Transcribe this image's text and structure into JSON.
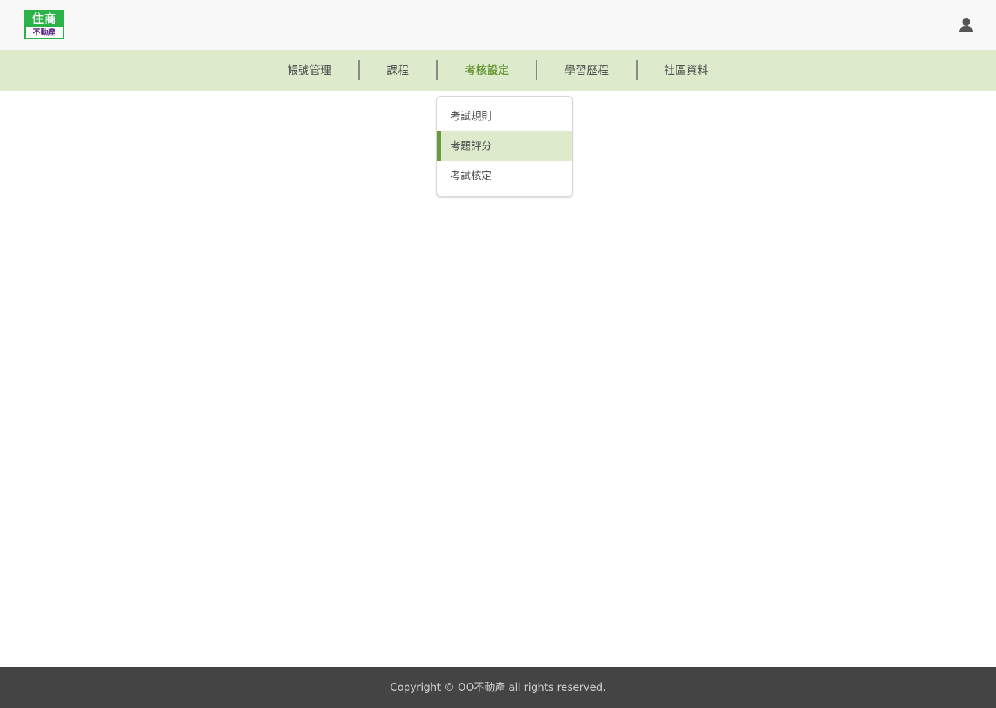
{
  "header": {
    "logo": {
      "top_text": "住商",
      "bottom_text": "不動產"
    },
    "user_icon": "user-icon"
  },
  "nav": {
    "items": [
      {
        "label": "帳號管理",
        "active": false
      },
      {
        "label": "課程",
        "active": false
      },
      {
        "label": "考核設定",
        "active": true
      },
      {
        "label": "學習歷程",
        "active": false
      },
      {
        "label": "社區資料",
        "active": false
      }
    ]
  },
  "dropdown": {
    "items": [
      {
        "label": "考試規則",
        "selected": false
      },
      {
        "label": "考題評分",
        "selected": true
      },
      {
        "label": "考試核定",
        "selected": false
      }
    ]
  },
  "footer": {
    "text": "Copyright © OO不動產 all rights reserved."
  },
  "colors": {
    "brand_green": "#2bb34a",
    "nav_background": "#ddebcc",
    "accent_green": "#6a9a3a",
    "footer_background": "#444444"
  }
}
